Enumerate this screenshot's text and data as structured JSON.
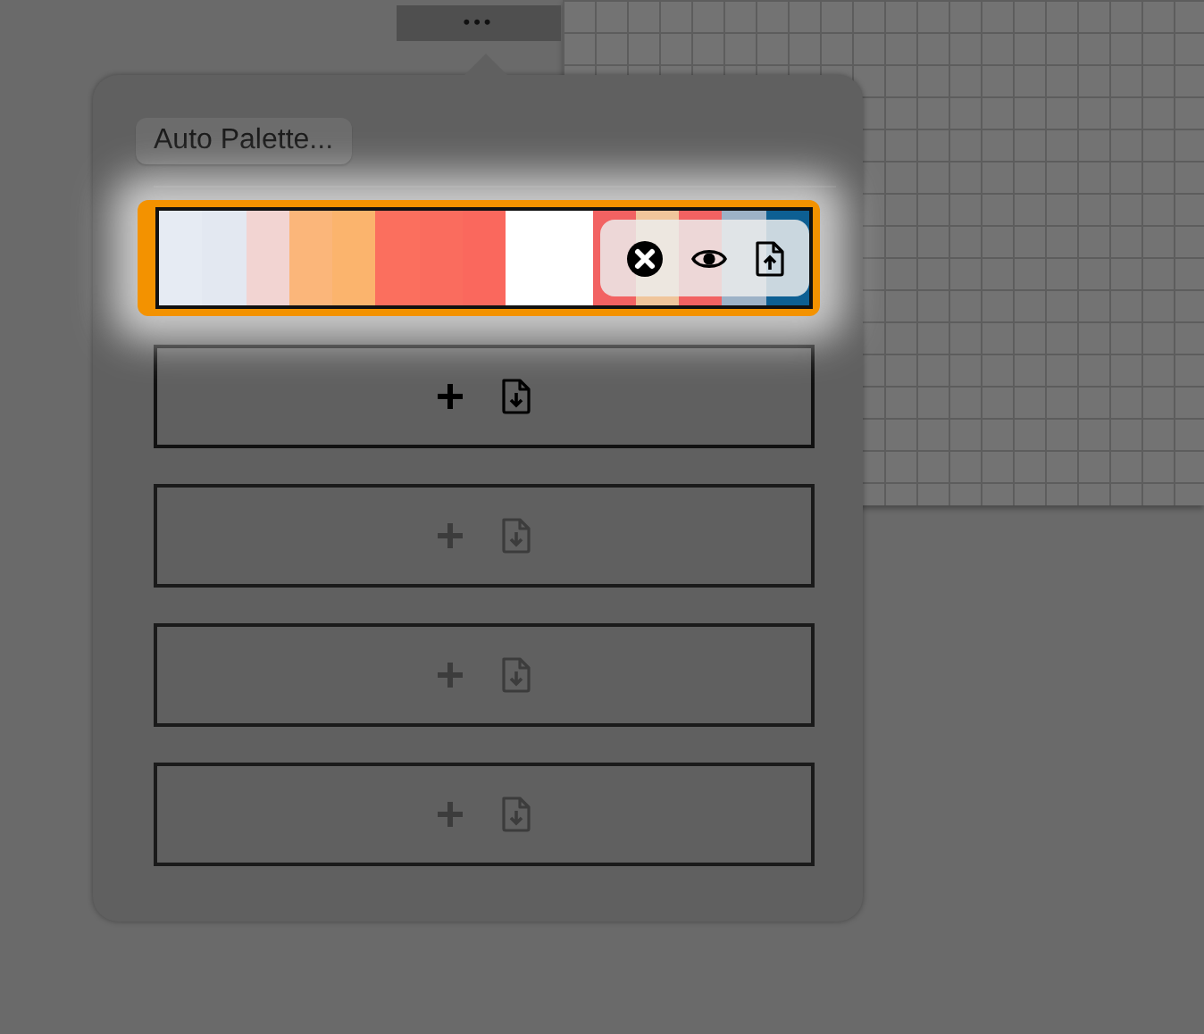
{
  "toolbar_handle": {
    "label": "•••"
  },
  "auto_palette_button": {
    "label": "Auto Palette..."
  },
  "palettes": [
    {
      "selected": true,
      "swatches": [
        {
          "color": "#e6ebf3"
        },
        {
          "color": "#e3e8f1"
        },
        {
          "color": "#f2d4d2"
        },
        {
          "color": "#fbb67a"
        },
        {
          "color": "#fbb46d"
        },
        {
          "color": "#fb6f5e"
        },
        {
          "color": "#fa6c5e"
        },
        {
          "color": "#fa685d"
        },
        {
          "color": "#ffffff"
        },
        {
          "color": "#ffffff"
        },
        {
          "color": "#f26262"
        },
        {
          "color": "#f0c59b"
        },
        {
          "color": "#f26262"
        },
        {
          "color": "#9db2c7"
        },
        {
          "color": "#0d5f93"
        }
      ]
    }
  ],
  "empty_slots": [
    {
      "disabled": false
    },
    {
      "disabled": true
    },
    {
      "disabled": true
    },
    {
      "disabled": true
    }
  ]
}
